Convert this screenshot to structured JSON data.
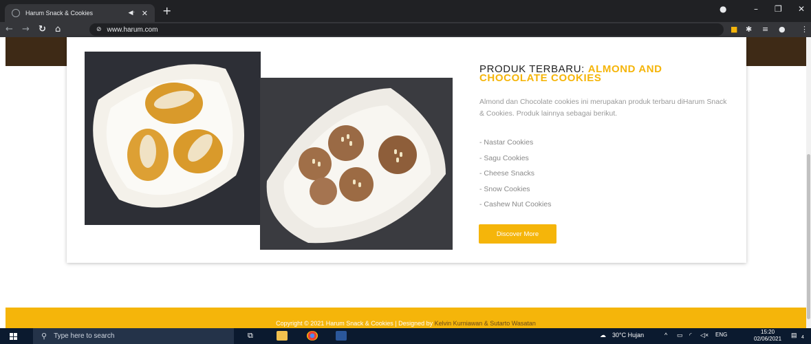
{
  "browser": {
    "tab_title": "Harum Snack & Cookies",
    "audio_icon": "speaker-icon",
    "url": "www.harum.com"
  },
  "product": {
    "heading_plain": "PRODUK TERBARU: ",
    "heading_accent": "ALMOND AND CHOCOLATE COOKIES",
    "description": "Almond dan Chocolate cookies ini merupakan produk terbaru diHarum Snack & Cookies. Produk lainnya sebagai berikut.",
    "items": [
      "- Nastar Cookies",
      "- Sagu Cookies",
      "- Cheese Snacks",
      "- Snow Cookies",
      "- Cashew Nut Cookies"
    ],
    "button_label": "Discover More"
  },
  "footer": {
    "copyright": "Copyright © 2021 Harum Snack & Cookies | Designed by ",
    "authors": "Kelvin Kurniawan & Sutarto Wasatan"
  },
  "taskbar": {
    "search_placeholder": "Type here to search",
    "weather": "30°C  Hujan",
    "language": "ENG",
    "time": "15:20",
    "date": "02/06/2021",
    "notification_count": "4"
  },
  "colors": {
    "accent": "#f5b50a",
    "hero_brown": "#3e2a16",
    "browser_dark": "#202124",
    "taskbar": "#0b1a2f"
  }
}
